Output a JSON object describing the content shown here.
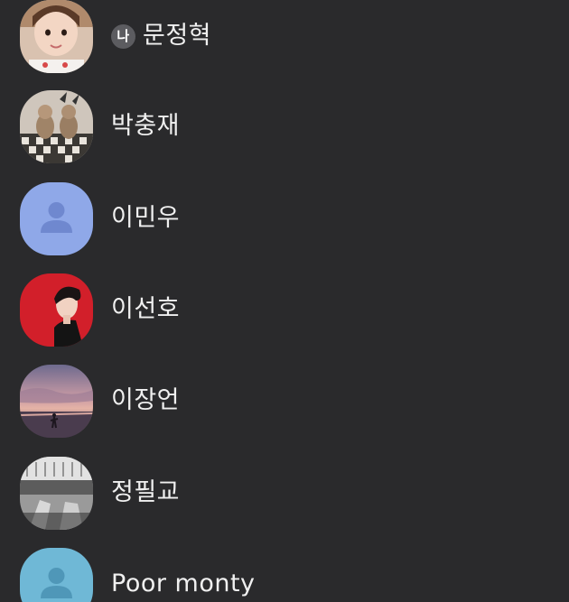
{
  "friends": [
    {
      "name": "문정혁",
      "badge": "나",
      "avatar": "photo-girl-portrait"
    },
    {
      "name": "박충재",
      "avatar": "photo-toy-figures"
    },
    {
      "name": "이민우",
      "avatar": "default-person",
      "avatar_color": "#8fa8e8"
    },
    {
      "name": "이선호",
      "avatar": "photo-man-red-background"
    },
    {
      "name": "이장언",
      "avatar": "photo-sunset-beach"
    },
    {
      "name": "정필교",
      "avatar": "photo-black-white"
    },
    {
      "name": "Poor monty",
      "avatar": "default-person",
      "avatar_color": "#6fb8d6"
    }
  ],
  "colors": {
    "background": "#2a2a2c",
    "text": "#f0f0f0",
    "badge": "#5c5c60"
  }
}
